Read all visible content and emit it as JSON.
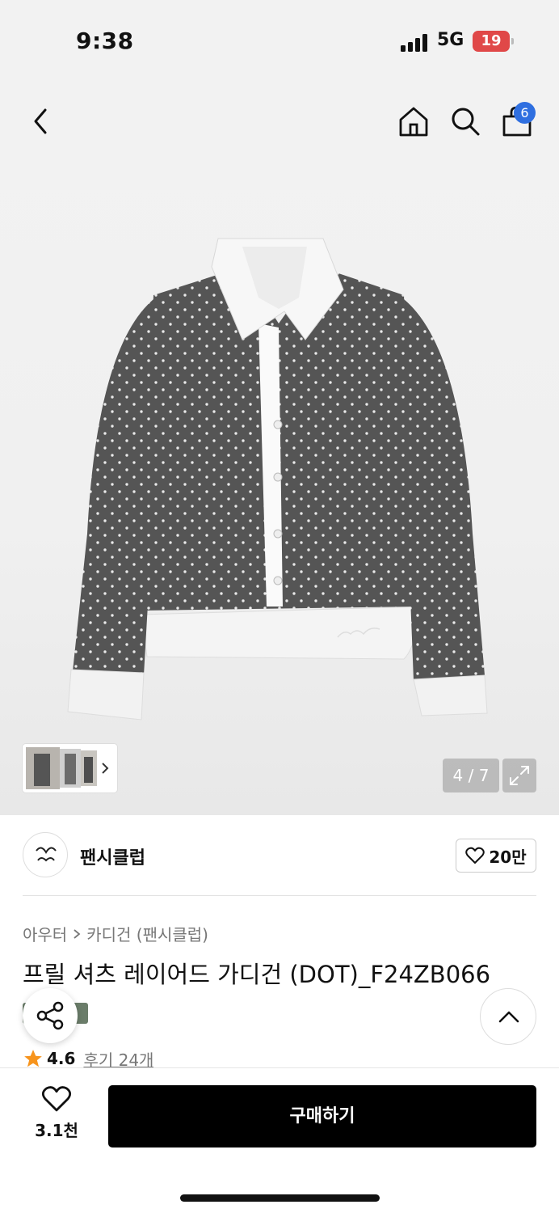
{
  "status_bar": {
    "time": "9:38",
    "network": "5G",
    "battery": "19"
  },
  "header": {
    "cart_count": "6",
    "icons": [
      "back-icon",
      "home-icon",
      "search-icon",
      "shopping-bag-icon"
    ]
  },
  "gallery": {
    "counter": "4 / 7",
    "image_alt": "grey polka-dot cardigan with white shirt collar layer"
  },
  "brand": {
    "name": "팬시클럽",
    "likes": "20만"
  },
  "breadcrumb": {
    "category": "아우터",
    "subcategory": "카디건 (팬시클럽)"
  },
  "product": {
    "title": "프릴 셔츠 레이어드 가디건 (DOT)_F24ZB066",
    "rating": "4.6",
    "reviews": "후기 24개"
  },
  "bottom": {
    "wish_count": "3.1천",
    "buy_label": "구매하기"
  },
  "colors": {
    "cart_badge": "#2f6fe0",
    "battery": "#e04848",
    "tag": "#6b7d6a",
    "star": "#f7941d",
    "buy_button": "#000000"
  }
}
